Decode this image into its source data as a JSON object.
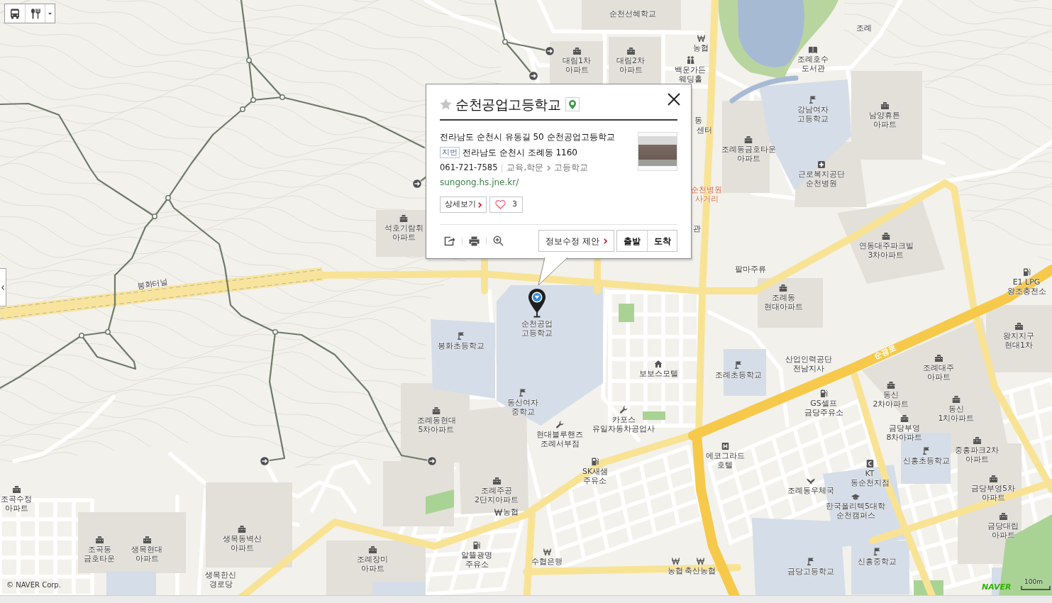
{
  "popup": {
    "title": "순천공업고등학교",
    "favorite": false,
    "road_address": "전라남도 순천시 유동길 50 순천공업고등학교",
    "lot_badge": "지번",
    "lot_address": "전라남도 순천시 조례동 1160",
    "phone": "061-721-7585",
    "categories": [
      "교육,학문",
      "고등학교"
    ],
    "website": "sungong.hs.jne.kr/",
    "detail_button": "상세보기",
    "liked": false,
    "like_count": "3",
    "suggest_button": "정보수정 제안",
    "route_buttons": [
      "출발",
      "도착"
    ]
  },
  "map": {
    "labels": [
      {
        "kind": "none",
        "lines": [
          "순천선혜학교"
        ]
      },
      {
        "kind": "none",
        "lines": [
          "조례"
        ]
      },
      {
        "kind": "bank",
        "lines": [
          "농협"
        ]
      },
      {
        "kind": "apartment",
        "lines": [
          "대림1차",
          "아파트"
        ]
      },
      {
        "kind": "apartment",
        "lines": [
          "대림2차",
          "아파트"
        ]
      },
      {
        "kind": "wedding",
        "lines": [
          "백운가든",
          "웨딩홀"
        ]
      },
      {
        "kind": "library",
        "lines": [
          "조례호수",
          "도서관"
        ]
      },
      {
        "kind": "none",
        "lines": [
          "동"
        ]
      },
      {
        "kind": "none",
        "lines": [
          "센터"
        ]
      },
      {
        "kind": "school",
        "lines": [
          "강남여자",
          "고등학교"
        ]
      },
      {
        "kind": "apartment",
        "lines": [
          "남양휴튼",
          "아파트"
        ]
      },
      {
        "kind": "apartment",
        "lines": [
          "조례동금호타운",
          "아파트"
        ]
      },
      {
        "kind": "hospital",
        "lines": [
          "근로복지공단",
          "순천병원"
        ]
      },
      {
        "kind": "intersection",
        "lines": [
          "순천병원",
          "사거리"
        ]
      },
      {
        "kind": "apartment",
        "lines": [
          "석호기람휘",
          "아파트"
        ]
      },
      {
        "kind": "none",
        "lines": [
          "관"
        ]
      },
      {
        "kind": "apartment",
        "lines": [
          "연동대주파크빌",
          "3차아파트"
        ]
      },
      {
        "kind": "none",
        "lines": [
          "팔마주류"
        ]
      },
      {
        "kind": "road",
        "lines": [
          "봉화터널"
        ]
      },
      {
        "kind": "gas",
        "lines": [
          "E1 LPG",
          "왕조충전소"
        ]
      },
      {
        "kind": "apartment",
        "lines": [
          "조례동",
          "현대아파트"
        ]
      },
      {
        "kind": "selected",
        "lines": [
          "순천공업",
          "고등학교"
        ]
      },
      {
        "kind": "school",
        "lines": [
          "봉화초등학교"
        ]
      },
      {
        "kind": "apartment",
        "lines": [
          "왕지지구",
          "현대1차"
        ]
      },
      {
        "kind": "motel",
        "lines": [
          "보보스모텔"
        ]
      },
      {
        "kind": "school",
        "lines": [
          "조례초등학교"
        ]
      },
      {
        "kind": "none",
        "lines": [
          "산업인력공단",
          "전남지사"
        ]
      },
      {
        "kind": "highway",
        "lines": [
          "순광로"
        ]
      },
      {
        "kind": "apartment",
        "lines": [
          "조례대주",
          "아파트"
        ]
      },
      {
        "kind": "apartment",
        "lines": [
          "동신",
          "2차아파트"
        ]
      },
      {
        "kind": "school",
        "lines": [
          "동산여자",
          "중학교"
        ]
      },
      {
        "kind": "gas",
        "lines": [
          "GS셀프",
          "금당주유소"
        ]
      },
      {
        "kind": "apartment",
        "lines": [
          "동신",
          "1치아파트"
        ]
      },
      {
        "kind": "apartment",
        "lines": [
          "조례동현대",
          "5차아파트"
        ]
      },
      {
        "kind": "repair",
        "lines": [
          "카포스",
          "유일자동차공업사"
        ]
      },
      {
        "kind": "repair",
        "lines": [
          "현대블루핸즈",
          "조례서부점"
        ]
      },
      {
        "kind": "apartment",
        "lines": [
          "금당부영",
          "8차아파트"
        ]
      },
      {
        "kind": "hotel",
        "lines": [
          "에코그라드",
          "호텔"
        ]
      },
      {
        "kind": "school",
        "lines": [
          "신흥초등학교"
        ]
      },
      {
        "kind": "apartment",
        "lines": [
          "중흥파크2차",
          "아파트"
        ]
      },
      {
        "kind": "gas",
        "lines": [
          "SK새샘",
          "주유소"
        ]
      },
      {
        "kind": "telecom",
        "lines": [
          "KT",
          "동순천지점"
        ]
      },
      {
        "kind": "apartment",
        "lines": [
          "조곡수정",
          "아파트"
        ]
      },
      {
        "kind": "apartment",
        "lines": [
          "조례주공",
          "2단지아파트"
        ]
      },
      {
        "kind": "post",
        "lines": [
          "조례동우체국"
        ]
      },
      {
        "kind": "apartment",
        "lines": [
          "금당부영5차",
          "아파트"
        ]
      },
      {
        "kind": "bank",
        "lines": [
          "농협"
        ]
      },
      {
        "kind": "college",
        "lines": [
          "한국폴리텍5대학",
          "순천캠퍼스"
        ]
      },
      {
        "kind": "apartment",
        "lines": [
          "금당대립",
          "아파트"
        ]
      },
      {
        "kind": "apartment",
        "lines": [
          "생목동벽산",
          "아파트"
        ]
      },
      {
        "kind": "apartment",
        "lines": [
          "조곡동",
          "금호타운"
        ]
      },
      {
        "kind": "apartment",
        "lines": [
          "생목현대",
          "아파트"
        ]
      },
      {
        "kind": "apartment",
        "lines": [
          "조례장미",
          "아파트"
        ]
      },
      {
        "kind": "gas",
        "lines": [
          "알뜰광명",
          "주유소"
        ]
      },
      {
        "kind": "bank",
        "lines": [
          "수협은행"
        ]
      },
      {
        "kind": "school",
        "lines": [
          "신흥중학교"
        ]
      },
      {
        "kind": "none",
        "lines": [
          "생목한신",
          "경로당"
        ]
      },
      {
        "kind": "bank",
        "lines": [
          "농협"
        ]
      },
      {
        "kind": "bank",
        "lines": [
          "축산농협"
        ]
      },
      {
        "kind": "school",
        "lines": [
          "금당고등학교"
        ]
      }
    ],
    "copyright": "© NAVER Corp.",
    "logo": "NAVER",
    "scale": "100m"
  }
}
